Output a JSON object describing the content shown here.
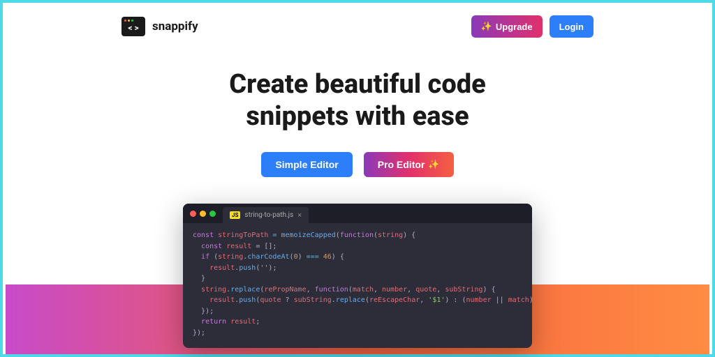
{
  "brand": "snappify",
  "header": {
    "upgrade_label": "Upgrade",
    "login_label": "Login"
  },
  "hero": {
    "title_line1": "Create beautiful code",
    "title_line2": "snippets with ease"
  },
  "cta": {
    "simple_label": "Simple Editor",
    "pro_label": "Pro Editor"
  },
  "code_window": {
    "filename": "string-to-path.js",
    "lang_badge": "JS",
    "lines": {
      "l1_a": "const",
      "l1_b": "stringToPath",
      "l1_c": "=",
      "l1_d": "memoizeCapped",
      "l1_e": "function",
      "l1_f": "string",
      "l2_a": "const",
      "l2_b": "result",
      "l2_c": "= [];",
      "l3_a": "if",
      "l3_b": "string",
      "l3_c": "charCodeAt",
      "l3_d": "0",
      "l3_e": "===",
      "l3_f": "46",
      "l4_a": "result",
      "l4_b": "push",
      "l4_c": "''",
      "l6_a": "string",
      "l6_b": "replace",
      "l6_c": "rePropName",
      "l6_d": "function",
      "l6_e": "match",
      "l6_f": "number",
      "l6_g": "quote",
      "l6_h": "subString",
      "l7_a": "result",
      "l7_b": "push",
      "l7_c": "quote",
      "l7_d": "subString",
      "l7_e": "replace",
      "l7_f": "reEscapeChar",
      "l7_g": "'$1'",
      "l7_h": "number",
      "l7_i": "match",
      "l9_a": "return",
      "l9_b": "result"
    }
  }
}
